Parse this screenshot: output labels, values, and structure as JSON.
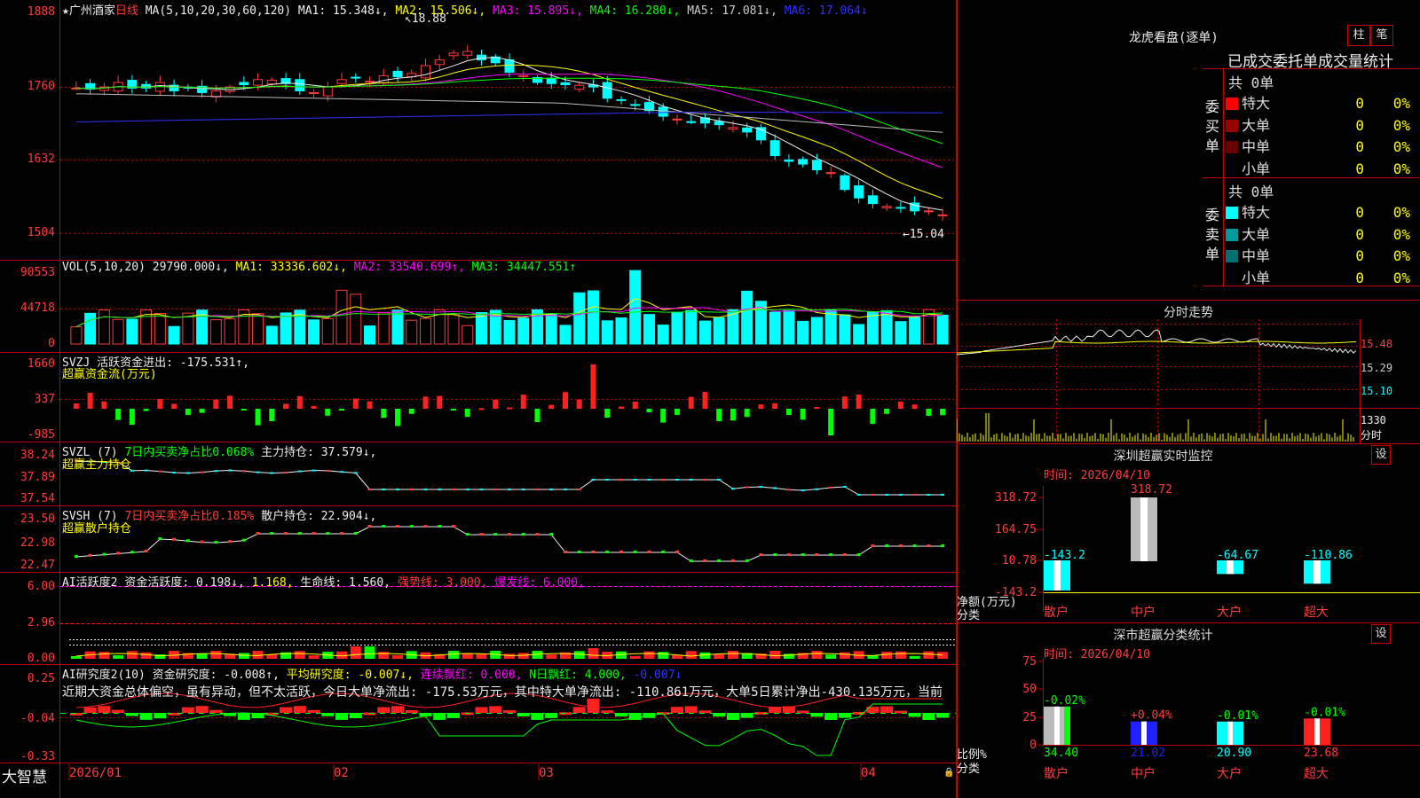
{
  "stock": {
    "star": "★",
    "name": "广州酒家",
    "period": "日线"
  },
  "ma": {
    "spec": "MA(5,10,20,30,60,120)",
    "items": [
      {
        "label": "MA1: 15.348↓,",
        "color": "#eeeeee"
      },
      {
        "label": "MA2: 15.506↓,",
        "color": "#ffff00"
      },
      {
        "label": "MA3: 15.895↓,",
        "color": "#ff00ff"
      },
      {
        "label": "MA4: 16.280↓,",
        "color": "#00ff00"
      },
      {
        "label": "MA5: 17.081↓,",
        "color": "#cccccc"
      },
      {
        "label": "MA6: 17.064↓",
        "color": "#3030ff"
      }
    ]
  },
  "price_axis": [
    "1888",
    "1760",
    "1632",
    "1504"
  ],
  "high_mark": "18.88",
  "low_mark": "←15.04",
  "vol": {
    "spec": "VOL(5,10,20)",
    "value": "29790.000↓,",
    "ma1": "MA1: 33336.602↓,",
    "ma2": "MA2: 33540.699↑,",
    "ma3": "MA3: 34447.551↑",
    "axis": [
      "90553",
      "44718",
      "0"
    ]
  },
  "svzj": {
    "name": "SVZJ",
    "label": "活跃资金进出: -175.531↑,",
    "sub": "超赢资金流(万元)",
    "axis": [
      "1660",
      "337",
      "-985"
    ]
  },
  "svzl": {
    "name": "SVZL (7)",
    "pct": "7日内买卖净占比0.068%",
    "hold": "主力持仓: 37.579↓,",
    "sub": "超赢主力持仓",
    "axis": [
      "38.24",
      "37.89",
      "37.54"
    ]
  },
  "svsh": {
    "name": "SVSH (7)",
    "pct": "7日内买卖净占比0.185%",
    "hold": "散户持仓: 22.904↓,",
    "sub": "超赢散户持仓",
    "axis": [
      "23.50",
      "22.98",
      "22.47"
    ]
  },
  "ai1": {
    "name": "AI活跃度2",
    "a": "资金活跃度: 0.198↓,",
    "b": "1.168,",
    "c": "生命线: 1.560,",
    "d": "强势线: 3.000,",
    "e": "爆发线: 6.000,",
    "axis": [
      "6.00",
      "2.96",
      "0.00"
    ]
  },
  "ai2": {
    "name": "AI研究度2(10)",
    "a": "资金研究度: -0.008↑,",
    "b": "平均研究度: -0.007↓,",
    "c": "连续飘红: 0.000,",
    "d": "N日飘红: 4.000,",
    "e": "-0.007↓",
    "axis": [
      "0.25",
      "-0.04",
      "-0.33"
    ],
    "comment": "近期大资金总体偏空，虽有异动，但不太活跃，今日大单净流出: -175.53万元，其中特大单净流出: -110.861万元，大单5日累计净出-430.135万元，当前"
  },
  "dates": [
    "2026/01",
    "02",
    "03",
    "04"
  ],
  "brand": "大智慧",
  "dragon": {
    "title": "龙虎看盘(逐单)",
    "btn1": "柱",
    "btn2": "笔",
    "header": "已成交委托单成交量统计",
    "buy": {
      "side": "委买单",
      "total": "共 0单",
      "rows": [
        {
          "name": "特大",
          "val": "0",
          "pct": "0%",
          "color": "#ff0000"
        },
        {
          "name": "大单",
          "val": "0",
          "pct": "0%",
          "color": "#9a0000"
        },
        {
          "name": "中单",
          "val": "0",
          "pct": "0%",
          "color": "#6a0000"
        },
        {
          "name": "小单",
          "val": "0",
          "pct": "0%",
          "color": ""
        }
      ]
    },
    "sell": {
      "side": "委卖单",
      "total": "共 0单",
      "rows": [
        {
          "name": "特大",
          "val": "0",
          "pct": "0%",
          "color": "#00ffff"
        },
        {
          "name": "大单",
          "val": "0",
          "pct": "0%",
          "color": "#009a9a"
        },
        {
          "name": "中单",
          "val": "0",
          "pct": "0%",
          "color": "#007070"
        },
        {
          "name": "小单",
          "val": "0",
          "pct": "0%",
          "color": ""
        }
      ]
    }
  },
  "intraday": {
    "title": "分时走势",
    "axis": [
      "15.48",
      "15.29",
      "15.10"
    ],
    "vol_axis": "1330",
    "vol_unit": "分时"
  },
  "sz_monitor": {
    "title": "深圳超赢实时监控",
    "btn": "设",
    "time": "时间: 2026/04/10",
    "axis": [
      "318.72",
      "164.75",
      "10.78",
      "-143.2"
    ],
    "ylabel": "净额(万元)",
    "xlabel": "分类",
    "cats": [
      "散户",
      "中户",
      "大户",
      "超大"
    ],
    "vals": [
      "-143.2",
      "318.72",
      "-64.67",
      "-110.86"
    ]
  },
  "sz_class": {
    "title": "深市超赢分类统计",
    "btn": "设",
    "time": "时间: 2026/04/10",
    "axis": [
      "75",
      "50",
      "25",
      "0"
    ],
    "ylabel": "比例%",
    "xlabel": "分类",
    "cats": [
      "散户",
      "中户",
      "大户",
      "超大"
    ],
    "tops": [
      "-0.02%",
      "+0.04%",
      "-0.01%",
      "-0.01%"
    ],
    "vals": [
      "34.40",
      "21.02",
      "20.90",
      "23.68"
    ]
  },
  "chart_data": {
    "type": "candlestick",
    "title": "广州酒家 日线",
    "close_approx": [
      17.6,
      17.58,
      17.62,
      17.7,
      17.6,
      17.6,
      17.7,
      17.55,
      17.6,
      17.52,
      17.55,
      17.62,
      17.66,
      17.75,
      17.74,
      17.68,
      17.55,
      17.52,
      17.62,
      17.75,
      17.78,
      17.72,
      17.82,
      17.8,
      17.86,
      18.0,
      18.1,
      18.22,
      18.25,
      18.1,
      18.05,
      17.88,
      17.82,
      17.7,
      17.68,
      17.66,
      17.65,
      17.62,
      17.42,
      17.38,
      17.3,
      17.2,
      17.1,
      17.05,
      17.0,
      16.98,
      16.95,
      16.9,
      16.82,
      16.68,
      16.4,
      16.3,
      16.25,
      16.15,
      16.1,
      15.8,
      15.65,
      15.55,
      15.5,
      15.48,
      15.42,
      15.42,
      15.35
    ],
    "high": 18.88,
    "low": 15.04,
    "volume_max": 90553,
    "ma_values": [
      15.348,
      15.506,
      15.895,
      16.28,
      17.081,
      17.064
    ]
  }
}
